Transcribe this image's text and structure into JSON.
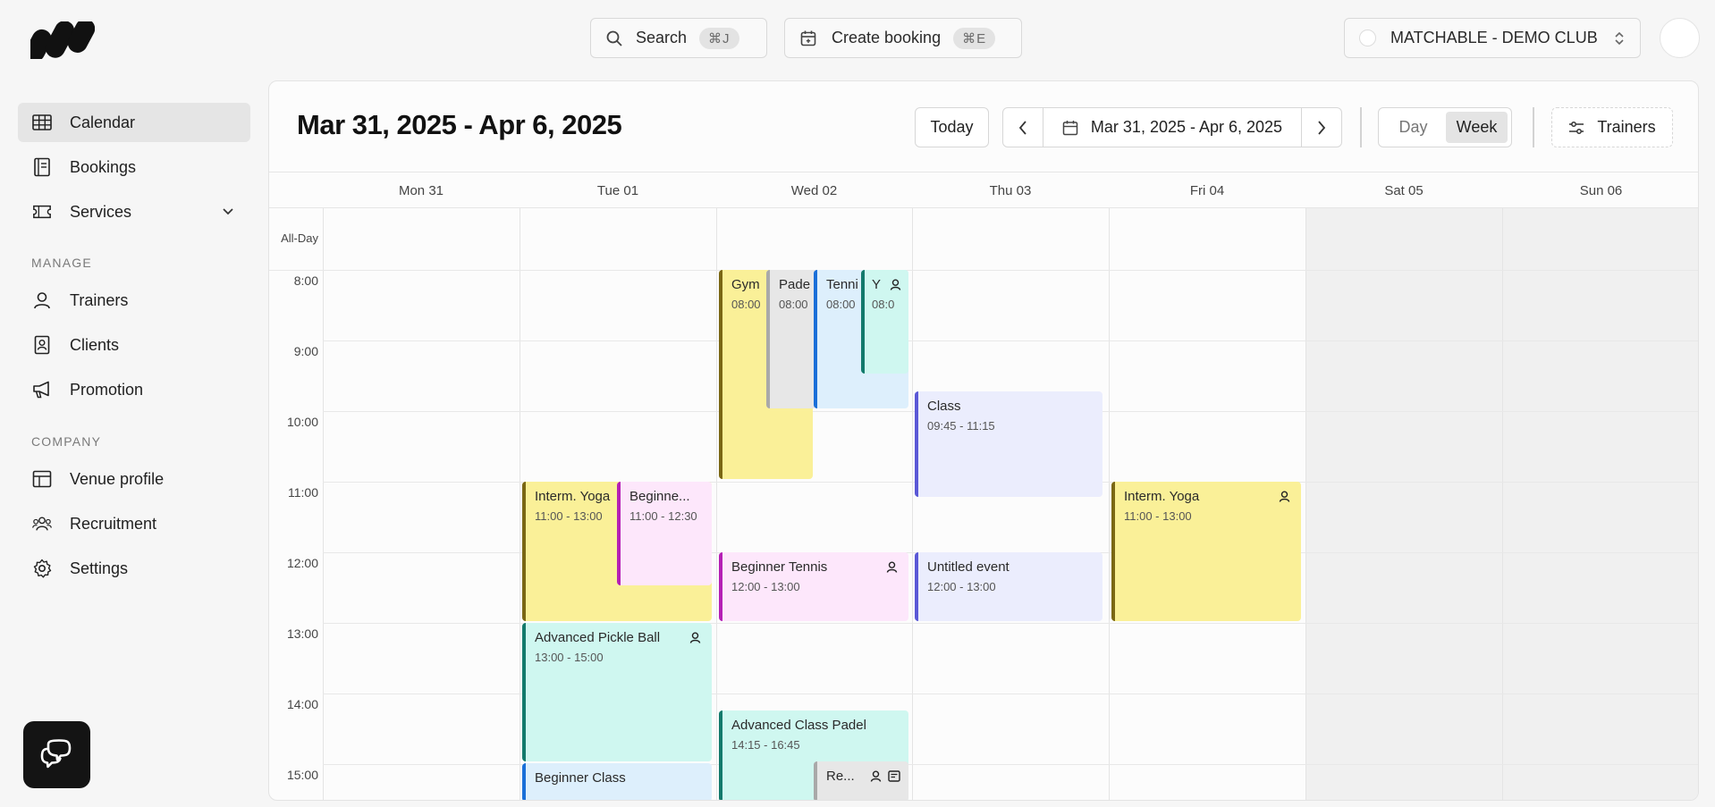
{
  "app": {
    "search": {
      "label": "Search",
      "shortcut": "⌘J"
    },
    "create_booking": {
      "label": "Create booking",
      "shortcut": "⌘E"
    },
    "club": {
      "name": "MATCHABLE - DEMO CLUB"
    }
  },
  "sidebar": {
    "calendar": "Calendar",
    "bookings": "Bookings",
    "services": "Services",
    "manage_label": "MANAGE",
    "trainers": "Trainers",
    "clients": "Clients",
    "promotion": "Promotion",
    "company_label": "COMPANY",
    "venue_profile": "Venue profile",
    "recruitment": "Recruitment",
    "settings": "Settings"
  },
  "header": {
    "title": "Mar 31, 2025 - Apr 6, 2025",
    "today": "Today",
    "range": "Mar 31, 2025 - Apr 6, 2025",
    "view_day": "Day",
    "view_week": "Week",
    "trainers": "Trainers"
  },
  "days": [
    "Mon 31",
    "Tue 01",
    "Wed 02",
    "Thu 03",
    "Fri 04",
    "Sat 05",
    "Sun 06"
  ],
  "all_day": "All-Day",
  "times": [
    "8:00",
    "9:00",
    "10:00",
    "11:00",
    "12:00",
    "13:00",
    "14:00",
    "15:00"
  ],
  "events": [
    {
      "title": "Gym",
      "time": "08:00"
    },
    {
      "title": "Pade",
      "time": "08:00"
    },
    {
      "title": "Tenni",
      "time": "08:00"
    },
    {
      "title": "Y",
      "time": "08:0"
    },
    {
      "title": "Class",
      "time": "09:45 - 11:15"
    },
    {
      "title": "Interm. Yoga",
      "time": "11:00 - 13:00"
    },
    {
      "title": "Beginne...",
      "time": "11:00 - 12:30"
    },
    {
      "title": "Interm. Yoga",
      "time": "11:00 - 13:00"
    },
    {
      "title": "Beginner Tennis",
      "time": "12:00 - 13:00"
    },
    {
      "title": "Untitled event",
      "time": "12:00 - 13:00"
    },
    {
      "title": "Advanced Pickle Ball",
      "time": "13:00 - 15:00"
    },
    {
      "title": "Advanced Class Padel",
      "time": "14:15 - 16:45"
    },
    {
      "title": "Re...",
      "time": ""
    },
    {
      "title": "Beginner Class",
      "time": ""
    }
  ]
}
